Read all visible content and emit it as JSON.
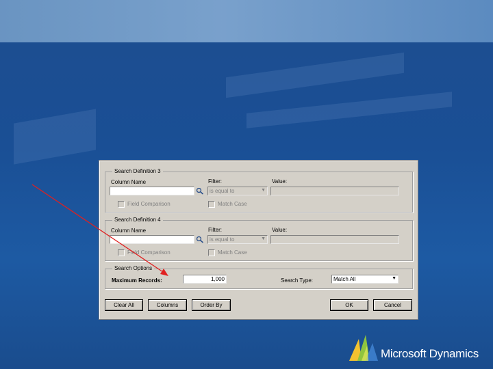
{
  "dialog": {
    "group3": {
      "legend": "Search Definition 3",
      "column_name_label": "Column Name",
      "filter_label": "Filter:",
      "value_label": "Value:",
      "filter_value": "is equal to",
      "field_comparison_label": "Field Comparison",
      "match_case_label": "Match Case"
    },
    "group4": {
      "legend": "Search Definition 4",
      "column_name_label": "Column Name",
      "filter_label": "Filter:",
      "value_label": "Value:",
      "filter_value": "is equal to",
      "field_comparison_label": "Field Comparison",
      "match_case_label": "Match Case"
    },
    "options": {
      "legend": "Search Options",
      "max_records_label": "Maximum Records:",
      "max_records_value": "1,000",
      "search_type_label": "Search Type:",
      "search_type_value": "Match All"
    },
    "buttons": {
      "clear_all": "Clear All",
      "columns": "Columns",
      "order_by": "Order By",
      "ok": "OK",
      "cancel": "Cancel"
    }
  },
  "brand": {
    "name": "Microsoft Dynamics"
  },
  "colors": {
    "background": "#1d4d8f",
    "arrow": "#e02020",
    "dialog": "#d4d0c8"
  },
  "icons": {
    "lookup": "lookup-magnifier-icon",
    "logo": "microsoft-dynamics-logo"
  }
}
